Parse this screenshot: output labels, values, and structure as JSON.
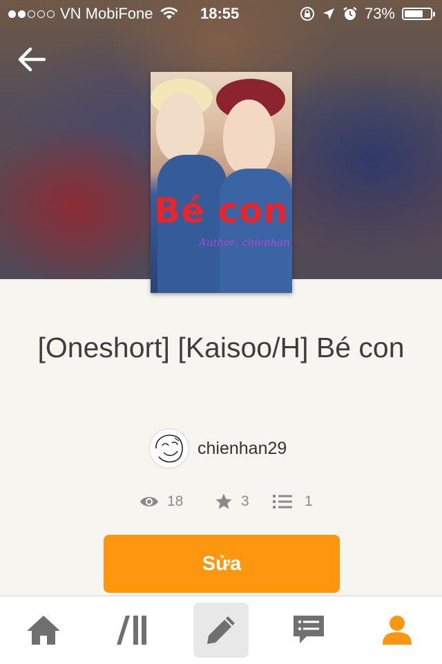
{
  "status_bar": {
    "carrier": "VN MobiFone",
    "time": "18:55",
    "battery_percent": "73%",
    "battery_level": 0.73,
    "signal_bars_filled": 2,
    "signal_bars_total": 5
  },
  "header": {
    "back_icon": "arrow-left-icon"
  },
  "story": {
    "cover_title": "Bé con",
    "cover_author_text": "Author: chienhan",
    "title": "[Oneshort] [Kaisoo/H] Bé con",
    "author": "chienhan29",
    "stats": {
      "views": "18",
      "votes": "3",
      "parts": "1"
    }
  },
  "actions": {
    "edit_label": "Sửa"
  },
  "tabbar": {
    "items": [
      {
        "name": "home",
        "icon": "home-icon"
      },
      {
        "name": "library",
        "icon": "library-icon"
      },
      {
        "name": "write",
        "icon": "pencil-icon",
        "active": true
      },
      {
        "name": "messages",
        "icon": "chat-icon"
      },
      {
        "name": "profile",
        "icon": "user-icon"
      }
    ]
  },
  "colors": {
    "accent": "#ff960f",
    "background": "#f6f5f0",
    "muted_text": "#8a8a8a",
    "cover_title": "#e8262a"
  }
}
